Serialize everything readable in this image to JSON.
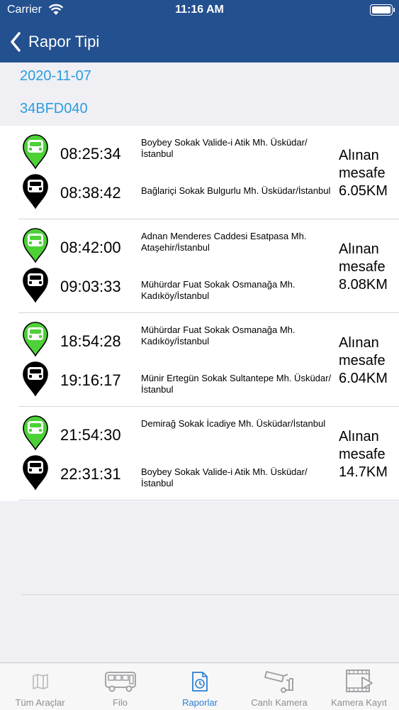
{
  "status_bar": {
    "carrier": "Carrier",
    "time": "11:16 AM"
  },
  "nav": {
    "title": "Rapor Tipi"
  },
  "report": {
    "date": "2020-11-07",
    "plate": "34BFD040"
  },
  "trips": [
    {
      "start_time": "08:25:34",
      "start_address": "Boybey Sokak Valide-i Atik Mh. Üsküdar/İstanbul",
      "end_time": "08:38:42",
      "end_address": "Bağlariçi Sokak Bulgurlu Mh. Üsküdar/İstanbul",
      "distance_label": "Alınan mesafe",
      "distance": "6.05KM"
    },
    {
      "start_time": "08:42:00",
      "start_address": "Adnan Menderes Caddesi Esatpasa Mh. Ataşehir/İstanbul",
      "end_time": "09:03:33",
      "end_address": "Mühürdar Fuat Sokak Osmanağa Mh. Kadıköy/İstanbul",
      "distance_label": "Alınan mesafe",
      "distance": "8.08KM"
    },
    {
      "start_time": "18:54:28",
      "start_address": "Mühürdar Fuat Sokak Osmanağa Mh. Kadıköy/İstanbul",
      "end_time": "19:16:17",
      "end_address": "Münir Ertegün Sokak Sultantepe Mh. Üsküdar/İstanbul",
      "distance_label": "Alınan mesafe",
      "distance": "6.04KM"
    },
    {
      "start_time": "21:54:30",
      "start_address": "Demirağ Sokak İcadiye Mh. Üsküdar/İstanbul",
      "end_time": "22:31:31",
      "end_address": "Boybey Sokak Valide-i Atik Mh. Üsküdar/İstanbul",
      "distance_label": "Alınan mesafe",
      "distance": "14.7KM"
    }
  ],
  "tabs": [
    {
      "label": "Tüm Araçlar",
      "icon": "map-icon"
    },
    {
      "label": "Filo",
      "icon": "bus-icon"
    },
    {
      "label": "Raporlar",
      "icon": "report-icon",
      "active": true
    },
    {
      "label": "Canlı Kamera",
      "icon": "security-camera-icon"
    },
    {
      "label": "Kamera Kayıt",
      "icon": "video-file-icon"
    }
  ],
  "colors": {
    "nav_background": "#23508f",
    "link_blue": "#2a9de0",
    "start_pin": "#4cd137",
    "end_pin": "#000000",
    "tab_active": "#2a7fd1",
    "tab_inactive": "#8e8e93"
  }
}
